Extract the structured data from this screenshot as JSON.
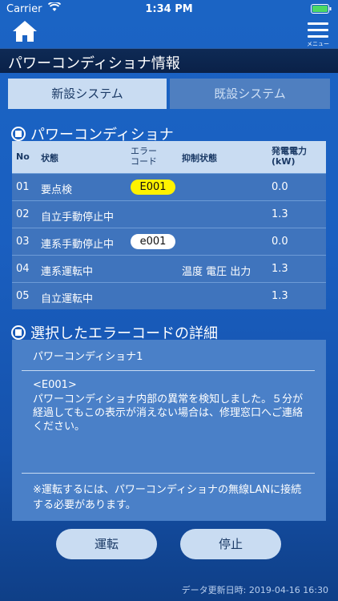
{
  "status_bar": {
    "carrier": "Carrier",
    "time": "1:34 PM"
  },
  "nav": {
    "menu_label": "メニュー"
  },
  "title": "パワーコンディショナ情報",
  "tabs": [
    {
      "label": "新設システム",
      "active": true
    },
    {
      "label": "既設システム",
      "active": false
    }
  ],
  "section1": {
    "heading": "パワーコンディショナ"
  },
  "table": {
    "headers": {
      "no": "No",
      "status": "状態",
      "error_code_1": "エラー",
      "error_code_2": "コード",
      "suppression": "抑制状態",
      "power_1": "発電電力",
      "power_2": "(kW)"
    },
    "rows": [
      {
        "no": "01",
        "status": "要点検",
        "error": "E001",
        "error_style": "yellow",
        "suppression": "",
        "power": "0.0"
      },
      {
        "no": "02",
        "status": "自立手動停止中",
        "error": "",
        "error_style": "",
        "suppression": "",
        "power": "1.3"
      },
      {
        "no": "03",
        "status": "連系手動停止中",
        "error": "e001",
        "error_style": "white",
        "suppression": "",
        "power": "0.0"
      },
      {
        "no": "04",
        "status": "連系運転中",
        "error": "",
        "error_style": "",
        "suppression": "温度 電圧 出力",
        "power": "1.3"
      },
      {
        "no": "05",
        "status": "自立運転中",
        "error": "",
        "error_style": "",
        "suppression": "",
        "power": "1.3"
      }
    ]
  },
  "section2": {
    "heading": "選択したエラーコードの詳細"
  },
  "detail": {
    "unit": "パワーコンディショナ1",
    "code": "<E001>",
    "message": "パワーコンディショナ内部の異常を検知しました。５分が経過してもこの表示が消えない場合は、修理窓口へご連絡ください。",
    "note": "※運転するには、パワーコンディショナの無線LANに接続する必要があります。"
  },
  "buttons": {
    "run": "運転",
    "stop": "停止"
  },
  "footer": {
    "updated": "データ更新日時: 2019-04-16 16:30"
  },
  "colors": {
    "accent": "#c9dcf2",
    "background": "#1a5fc0",
    "error_pill": "#fff200"
  }
}
